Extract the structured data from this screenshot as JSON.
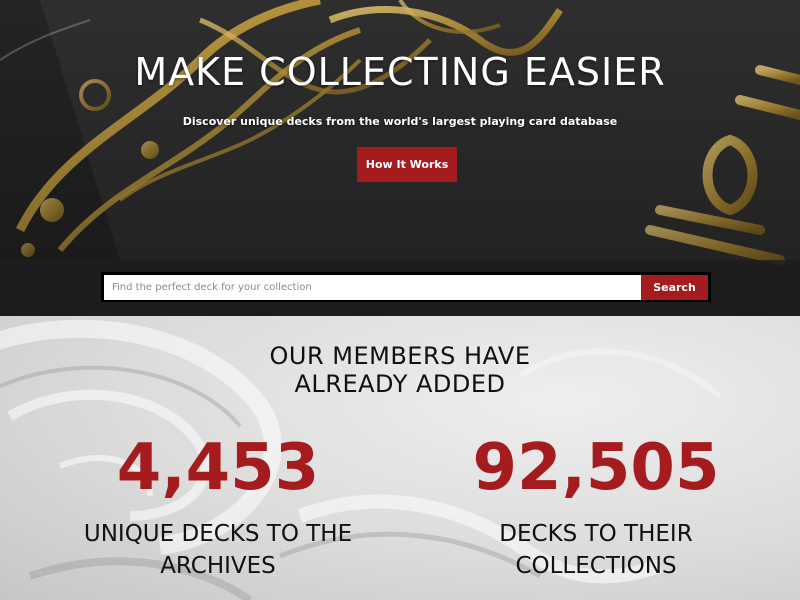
{
  "hero": {
    "title": "MAKE COLLECTING EASIER",
    "subtitle": "Discover unique decks from the world's largest playing card database",
    "cta_label": "How It Works"
  },
  "search": {
    "placeholder": "Find the perfect deck for your collection",
    "button_label": "Search"
  },
  "stats": {
    "heading_line1": "OUR MEMBERS HAVE",
    "heading_line2": "ALREADY ADDED",
    "items": [
      {
        "value": "4,453",
        "label_line1": "UNIQUE DECKS TO THE",
        "label_line2": "ARCHIVES"
      },
      {
        "value": "92,505",
        "label_line1": "DECKS TO THEIR",
        "label_line2": "COLLECTIONS"
      }
    ]
  },
  "colors": {
    "accent": "#a51c1f",
    "hero_bg": "#2a2a2a",
    "gold": "#c9a13b",
    "stats_bg": "#d9d9d9"
  }
}
